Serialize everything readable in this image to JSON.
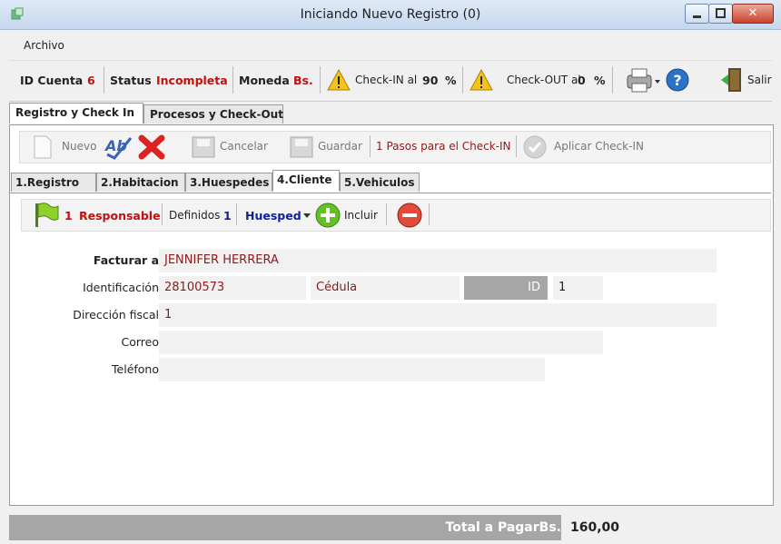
{
  "window": {
    "title": "Iniciando Nuevo Registro (0)",
    "close_glyph": "✕"
  },
  "menu": {
    "archivo": "Archivo"
  },
  "status": {
    "id_cuenta_label": "ID Cuenta",
    "id_cuenta_value": "6",
    "status_label": "Status",
    "status_value": "Incompleta",
    "moneda_label": "Moneda",
    "moneda_value": "Bs.",
    "checkin_label": "Check-IN al",
    "checkin_value": "90",
    "checkin_unit": "%",
    "checkout_label": "Check-OUT al",
    "checkout_value": "0",
    "checkout_unit": "%",
    "salir": "Salir"
  },
  "main_tabs": [
    "Registro y Check In",
    "Procesos y Check-Out"
  ],
  "toolbar": {
    "nuevo": "Nuevo",
    "cancelar": "Cancelar",
    "guardar": "Guardar",
    "pasos": "1 Pasos para el Check-IN",
    "aplicar": "Aplicar Check-IN"
  },
  "sub_tabs": [
    "1.Registro",
    "2.Habitacion",
    "3.Huespedes",
    "4.Cliente",
    "5.Vehiculos"
  ],
  "client_toolbar": {
    "responsable_count": "1",
    "responsable_label": "Responsable",
    "definidos_label": "Definidos",
    "definidos_value": "1",
    "huesped": "Huesped",
    "incluir": "Incluir"
  },
  "form": {
    "facturar_label": "Facturar a",
    "facturar_value": "JENNIFER HERRERA",
    "identificacion_label": "Identificación",
    "identificacion_value": "28100573",
    "tipo_doc": "Cédula",
    "id_label": "ID",
    "id_value": "1",
    "direccion_label": "Dirección fiscal",
    "direccion_value": "1",
    "correo_label": "Correo",
    "correo_value": "",
    "telefono_label": "Teléfono",
    "telefono_value": ""
  },
  "footer": {
    "total_label": "Total a PagarBs.",
    "total_value": "160,00"
  },
  "colors": {
    "accent_red": "#c01010",
    "value_red": "#8b1a1a",
    "blue": "#1020a0"
  },
  "icons": [
    "app-icon",
    "warning-icon",
    "printer-icon",
    "help-icon",
    "exit-door-icon",
    "new-document-icon",
    "spell-check-icon",
    "delete-x-icon",
    "cancel-save-icon",
    "save-icon",
    "apply-check-icon",
    "green-flag-icon",
    "add-circle-icon",
    "remove-circle-icon",
    "dropdown-arrow-icon"
  ]
}
